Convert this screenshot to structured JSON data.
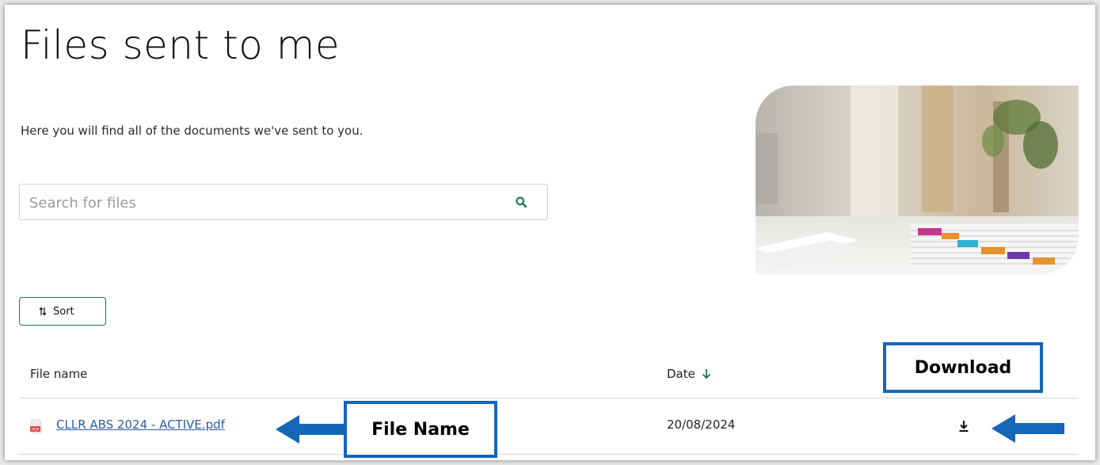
{
  "page": {
    "title": "Files sent to me",
    "intro": "Here you will find all of the documents we've sent to you."
  },
  "search": {
    "placeholder": "Search for files",
    "icon": "search-icon"
  },
  "toolbar": {
    "sort_label": "Sort",
    "sort_icon": "sort-arrows-icon"
  },
  "table": {
    "columns": {
      "name": "File name",
      "date": "Date"
    },
    "sort_direction_icon": "arrow-down-icon",
    "rows": [
      {
        "file_name": "CLLR ABS 2024 - ACTIVE.pdf",
        "file_type_icon": "pdf-file-icon",
        "date": "20/08/2024",
        "action_icon": "download-icon"
      }
    ]
  },
  "annotations": {
    "file_name_label": "File Name",
    "download_label": "Download"
  },
  "colors": {
    "accent_green": "#1a7a55",
    "link_blue": "#2a5d9f",
    "annotation_blue": "#1666b8",
    "pdf_red": "#d9473b"
  }
}
